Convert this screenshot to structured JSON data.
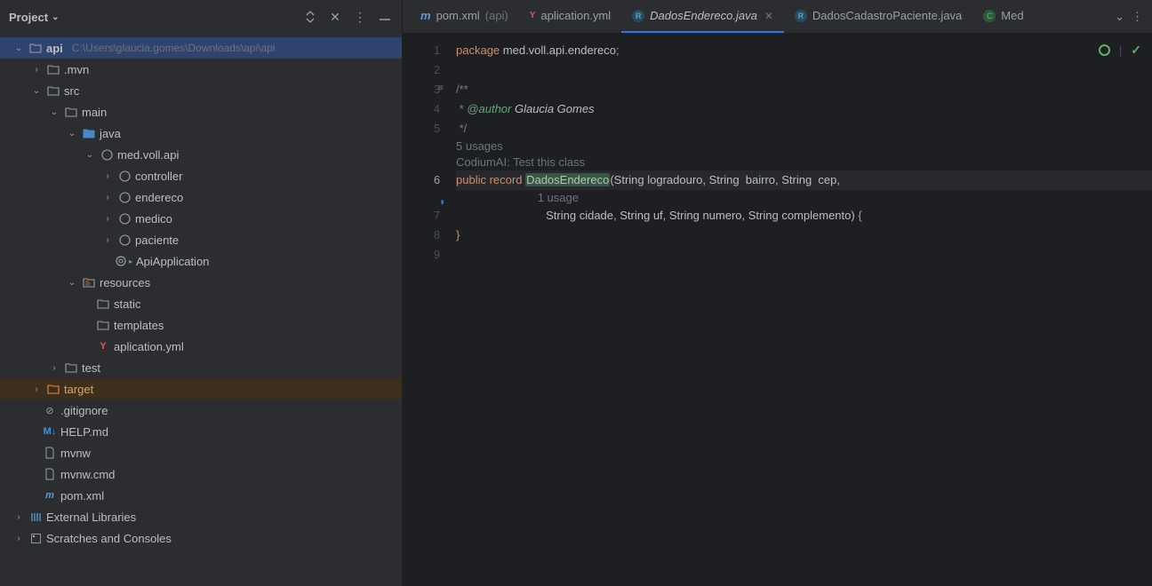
{
  "sidebar": {
    "title": "Project",
    "root": {
      "name": "api",
      "path": "C:\\Users\\glaucia.gomes\\Downloads\\api\\api"
    },
    "tree": {
      "mvn": ".mvn",
      "src": "src",
      "main": "main",
      "java": "java",
      "pkg": "med.voll.api",
      "controller": "controller",
      "endereco": "endereco",
      "medico": "medico",
      "paciente": "paciente",
      "apiapp": "ApiApplication",
      "resources": "resources",
      "static": "static",
      "templates": "templates",
      "aplication_yml": "aplication.yml",
      "test": "test",
      "target": "target",
      "gitignore": ".gitignore",
      "helpmd": "HELP.md",
      "mvnw": "mvnw",
      "mvnwcmd": "mvnw.cmd",
      "pomxml": "pom.xml",
      "extlib": "External Libraries",
      "scratches": "Scratches and Consoles"
    }
  },
  "tabs": {
    "pom": "pom.xml",
    "pom_scope": "(api)",
    "aplication": "aplication.yml",
    "dados_end": "DadosEndereco.java",
    "dados_cad": "DadosCadastroPaciente.java",
    "med": "Med"
  },
  "editor": {
    "pkg_kw": "package",
    "pkg_name": "med.voll.api.endereco",
    "comment_open": "/**",
    "comment_author": " * @author Glaucia Gomes",
    "comment_close": " */",
    "usages5": "5 usages",
    "codium": "CodiumAI: Test this class",
    "usage1": "1 usage",
    "public": "public",
    "record": "record",
    "cls": "DadosEndereco",
    "sig1": "String logradouro, String  bairro, String  cep,",
    "sig2": "String cidade, String uf, String numero, String complemento",
    "ln1": "1",
    "ln2": "2",
    "ln3": "3",
    "ln4": "4",
    "ln5": "5",
    "ln6": "6",
    "ln7": "7",
    "ln8": "8",
    "ln9": "9"
  }
}
